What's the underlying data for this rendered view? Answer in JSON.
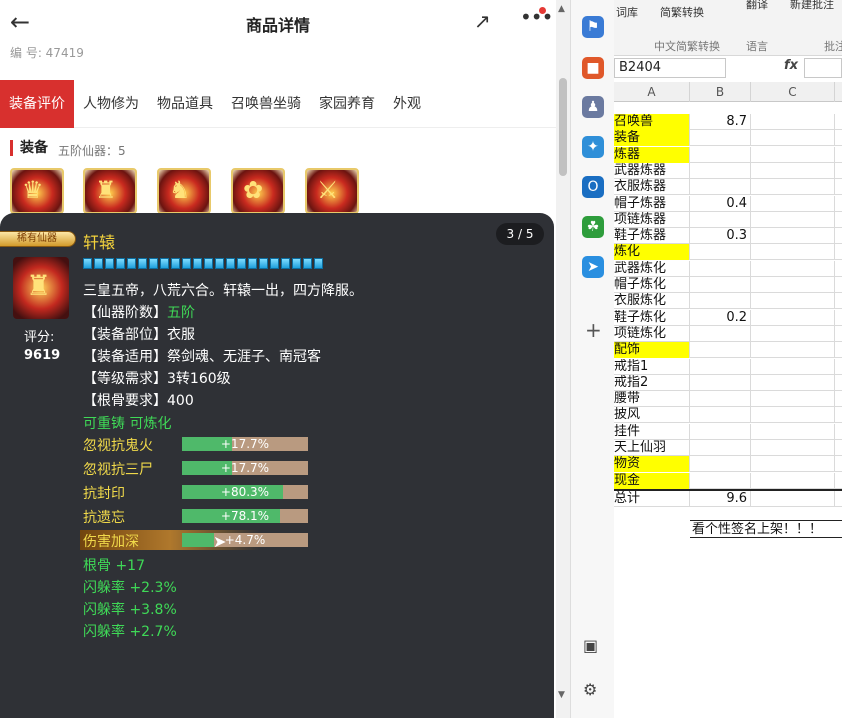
{
  "mobile": {
    "title": "商品详情",
    "id_line": "编 号: 47419",
    "tabs": [
      "装备评价",
      "人物修为",
      "物品道具",
      "召唤兽坐骑",
      "家园养育",
      "外观"
    ],
    "section_title": "装备",
    "section_sub": "五阶仙器：5",
    "icons": {
      "back": "back-arrow-icon",
      "share": "share-icon",
      "more": "more-icon"
    }
  },
  "tooltip": {
    "badge": "稀有仙器",
    "name": "轩辕",
    "pager": "3 / 5",
    "score_label": "评分:",
    "score_value": "9619",
    "description": "三皇五帝，八荒六合。轩辕一出，四方降服。",
    "attributes": [
      {
        "label": "【仙器阶数】",
        "value": "五阶"
      },
      {
        "label": "【装备部位】",
        "value": "衣服"
      },
      {
        "label": "【装备适用】",
        "value": "祭剑魂、无涯子、南冠客"
      },
      {
        "label": "【等级需求】",
        "value": "3转160级"
      },
      {
        "label": "【根骨要求】",
        "value": "400"
      }
    ],
    "refine": "可重铸 可炼化",
    "stats": [
      {
        "label": "忽视抗鬼火",
        "value": "+17.7%",
        "fill": 0.4
      },
      {
        "label": "忽视抗三尸",
        "value": "+17.7%",
        "fill": 0.4
      },
      {
        "label": "抗封印",
        "value": "+80.3%",
        "fill": 0.8
      },
      {
        "label": "抗遗忘",
        "value": "+78.1%",
        "fill": 0.78
      },
      {
        "label": "伤害加深",
        "value": "+4.7%",
        "fill": 0.25
      }
    ],
    "bonuses": [
      "根骨 +17",
      "闪躲率 +2.3%",
      "闪躲率 +3.8%",
      "闪躲率 +2.7%"
    ]
  },
  "excel": {
    "ribbon_top": [
      "词库",
      "简繁转换",
      "翻译",
      "新建批注"
    ],
    "ribbon_bottom": [
      "中文简繁转换",
      "语言",
      "批注"
    ],
    "name_box": "B2404",
    "col_headers": [
      "A",
      "B",
      "C"
    ],
    "rows": [
      {
        "a": "召唤兽",
        "b": "8.7",
        "yellow": true
      },
      {
        "a": "装备",
        "b": "",
        "yellow": true
      },
      {
        "a": "炼器",
        "b": "",
        "yellow": true
      },
      {
        "a": "武器炼器",
        "b": "",
        "yellow": false
      },
      {
        "a": "衣服炼器",
        "b": "",
        "yellow": false
      },
      {
        "a": "帽子炼器",
        "b": "0.4",
        "yellow": false
      },
      {
        "a": "项链炼器",
        "b": "",
        "yellow": false
      },
      {
        "a": "鞋子炼器",
        "b": "0.3",
        "yellow": false
      },
      {
        "a": "炼化",
        "b": "",
        "yellow": true
      },
      {
        "a": "武器炼化",
        "b": "",
        "yellow": false
      },
      {
        "a": "帽子炼化",
        "b": "",
        "yellow": false
      },
      {
        "a": "衣服炼化",
        "b": "",
        "yellow": false
      },
      {
        "a": "鞋子炼化",
        "b": "0.2",
        "yellow": false
      },
      {
        "a": "项链炼化",
        "b": "",
        "yellow": false
      },
      {
        "a": "配饰",
        "b": "",
        "yellow": true
      },
      {
        "a": "戒指1",
        "b": "",
        "yellow": false
      },
      {
        "a": "戒指2",
        "b": "",
        "yellow": false
      },
      {
        "a": "腰带",
        "b": "",
        "yellow": false
      },
      {
        "a": "披风",
        "b": "",
        "yellow": false
      },
      {
        "a": "挂件",
        "b": "",
        "yellow": false
      },
      {
        "a": "天上仙羽",
        "b": "",
        "yellow": false
      },
      {
        "a": "物资",
        "b": "",
        "yellow": true
      },
      {
        "a": "现金",
        "b": "",
        "yellow": true
      }
    ],
    "total_label": "总计",
    "total_value": "9.6",
    "note": "看个性签名上架！！！"
  }
}
